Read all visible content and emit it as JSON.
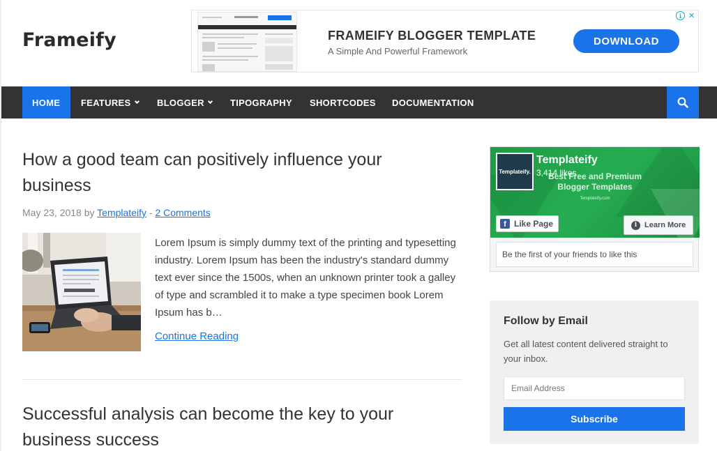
{
  "site": {
    "logo": "Frameify"
  },
  "ad": {
    "title": "FRAMEIFY BLOGGER TEMPLATE",
    "subtitle": "A Simple And Powerful Framework",
    "button": "DOWNLOAD"
  },
  "nav": {
    "items": [
      {
        "label": "HOME"
      },
      {
        "label": "FEATURES"
      },
      {
        "label": "BLOGGER"
      },
      {
        "label": "TIPOGRAPHY"
      },
      {
        "label": "SHORTCODES"
      },
      {
        "label": "DOCUMENTATION"
      }
    ]
  },
  "posts": [
    {
      "title": "How a good team can positively influence your business",
      "date": "May 23, 2018",
      "by": "by",
      "author": "Templateify",
      "separator": "-",
      "comments": "2 Comments",
      "excerpt": "Lorem Ipsum is simply dummy text of the printing and typesetting industry. Lorem Ipsum has been the industry's standard dummy text ever since the 1500s, when an unknown printer took a galley of type and scrambled it to make a type specimen book Lorem Ipsum has b…",
      "read_more": "Continue Reading"
    },
    {
      "title": "Successful analysis can become the key to your business success"
    }
  ],
  "facebook": {
    "page_name": "Templateify",
    "likes": "3,414 likes",
    "tagline": "Best Free and Premium Blogger Templates",
    "site": "Templateify.com",
    "logo_text": "Templateify.",
    "like_button": "Like Page",
    "learn_button": "Learn More",
    "friends_text": "Be the first of your friends to like this"
  },
  "follow": {
    "title": "Follow by Email",
    "description": "Get all latest content delivered straight to your inbox.",
    "placeholder": "Email Address",
    "button": "Subscribe"
  },
  "colors": {
    "accent": "#1a73e8",
    "nav_bg": "#333333",
    "fb_green": "#26ad52"
  }
}
